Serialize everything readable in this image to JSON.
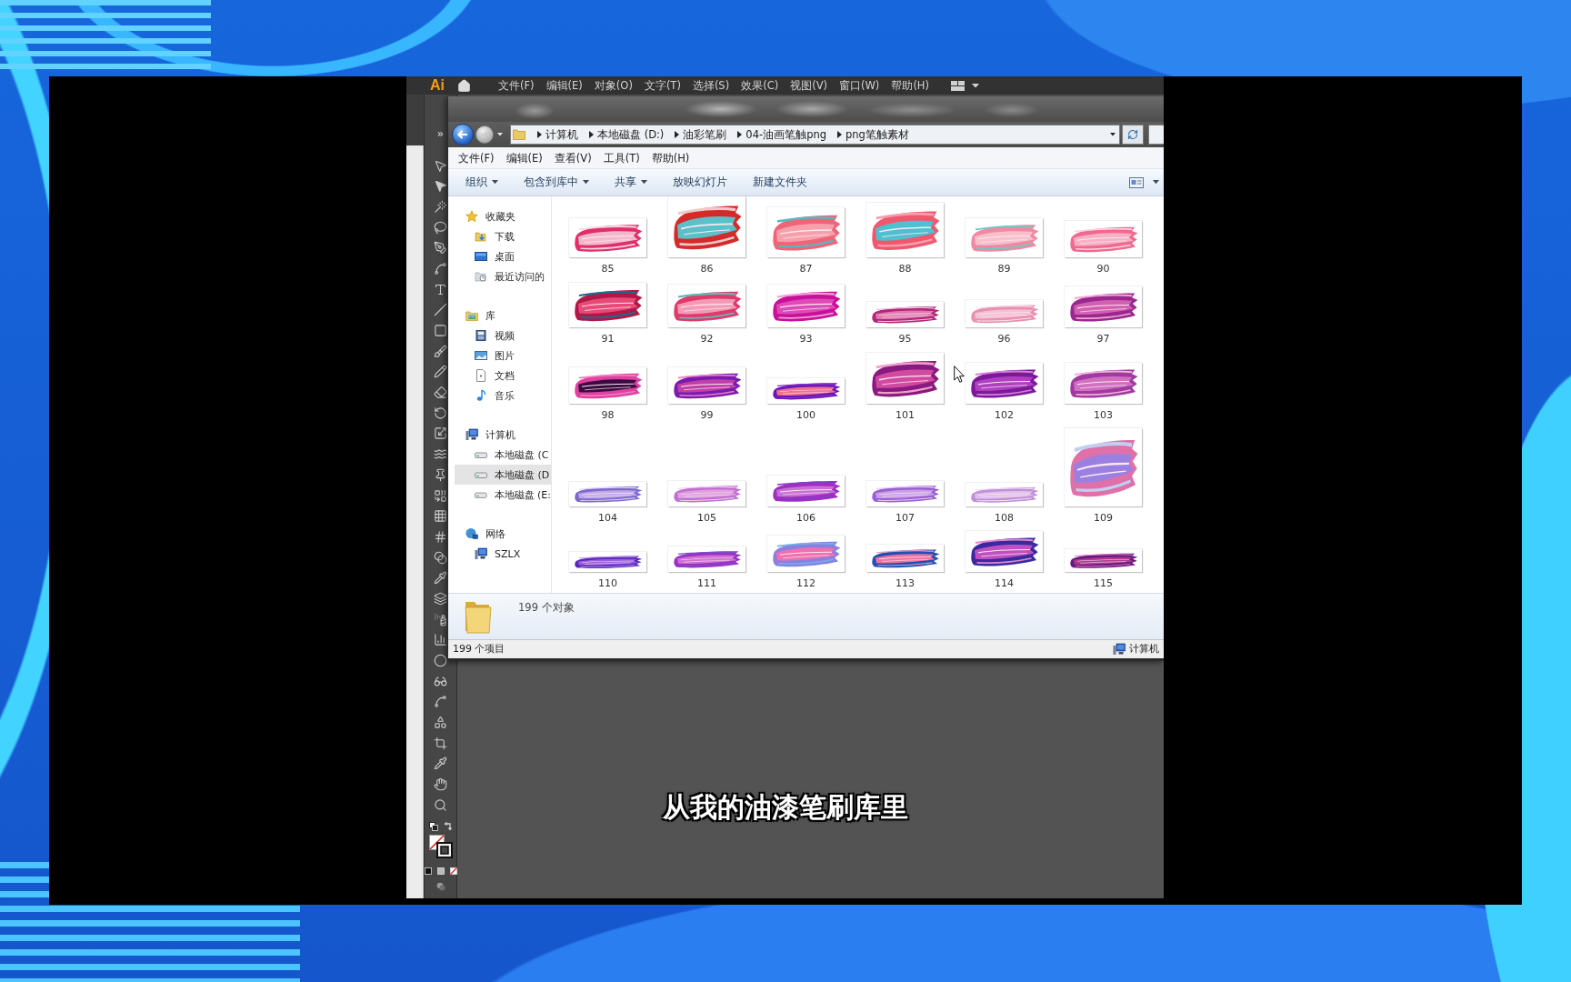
{
  "app_menu": {
    "logo": "Ai",
    "items": [
      "文件(F)",
      "编辑(E)",
      "对象(O)",
      "文字(T)",
      "选择(S)",
      "效果(C)",
      "视图(V)",
      "窗口(W)",
      "帮助(H)"
    ]
  },
  "explorer": {
    "nav_buttons": [
      {
        "kind": "back",
        "disabled": false
      },
      {
        "kind": "forward",
        "disabled": true
      }
    ],
    "breadcrumbs": [
      "计算机",
      "本地磁盘 (D:)",
      "油彩笔刷",
      "04-油画笔触png",
      "png笔触素材"
    ],
    "menu": [
      "文件(F)",
      "编辑(E)",
      "查看(V)",
      "工具(T)",
      "帮助(H)"
    ],
    "toolbar": [
      {
        "label": "组织",
        "kind": "menu"
      },
      {
        "label": "包含到库中",
        "kind": "menu"
      },
      {
        "label": "共享",
        "kind": "menu"
      },
      {
        "label": "放映幻灯片",
        "kind": "button"
      },
      {
        "label": "新建文件夹",
        "kind": "button"
      }
    ],
    "sidebar": [
      {
        "label": "收藏夹",
        "kind": "favorites",
        "selected": false,
        "children": [
          {
            "label": "下载",
            "kind": "downloads",
            "selected": false
          },
          {
            "label": "桌面",
            "kind": "desktop",
            "selected": false
          },
          {
            "label": "最近访问的",
            "kind": "recent",
            "selected": false
          }
        ]
      },
      {
        "label": "库",
        "kind": "libraries",
        "selected": false,
        "children": [
          {
            "label": "视频",
            "kind": "videos",
            "selected": false
          },
          {
            "label": "图片",
            "kind": "pictures",
            "selected": false
          },
          {
            "label": "文档",
            "kind": "documents",
            "selected": false
          },
          {
            "label": "音乐",
            "kind": "music",
            "selected": false
          }
        ]
      },
      {
        "label": "计算机",
        "kind": "computer",
        "selected": false,
        "children": [
          {
            "label": "本地磁盘 (C",
            "kind": "drive",
            "selected": false
          },
          {
            "label": "本地磁盘 (D",
            "kind": "drive",
            "selected": true
          },
          {
            "label": "本地磁盘 (E:",
            "kind": "drive",
            "selected": false
          }
        ]
      },
      {
        "label": "网络",
        "kind": "network",
        "selected": false,
        "children": [
          {
            "label": "SZLX",
            "kind": "host",
            "selected": false
          }
        ]
      }
    ],
    "files": [
      {
        "name": "85",
        "selected": false
      },
      {
        "name": "86",
        "selected": false
      },
      {
        "name": "87",
        "selected": false
      },
      {
        "name": "88",
        "selected": false
      },
      {
        "name": "89",
        "selected": false
      },
      {
        "name": "90",
        "selected": false
      },
      {
        "name": "91",
        "selected": false
      },
      {
        "name": "92",
        "selected": false
      },
      {
        "name": "93",
        "selected": false
      },
      {
        "name": "95",
        "selected": false
      },
      {
        "name": "96",
        "selected": false
      },
      {
        "name": "97",
        "selected": false
      },
      {
        "name": "98",
        "selected": false
      },
      {
        "name": "99",
        "selected": false
      },
      {
        "name": "100",
        "selected": false
      },
      {
        "name": "101",
        "selected": false
      },
      {
        "name": "102",
        "selected": false
      },
      {
        "name": "103",
        "selected": false
      },
      {
        "name": "104",
        "selected": false
      },
      {
        "name": "105",
        "selected": false
      },
      {
        "name": "106",
        "selected": false
      },
      {
        "name": "107",
        "selected": false
      },
      {
        "name": "108",
        "selected": false
      },
      {
        "name": "109",
        "selected": false
      },
      {
        "name": "110",
        "selected": false
      },
      {
        "name": "111",
        "selected": false
      },
      {
        "name": "112",
        "selected": false
      },
      {
        "name": "113",
        "selected": false
      },
      {
        "name": "114",
        "selected": false
      },
      {
        "name": "115",
        "selected": false
      }
    ],
    "details": "199 个对象",
    "status_bar": {
      "left": "199 个项目",
      "right": "计算机"
    }
  },
  "subtitle": "从我的油漆笔刷库里"
}
